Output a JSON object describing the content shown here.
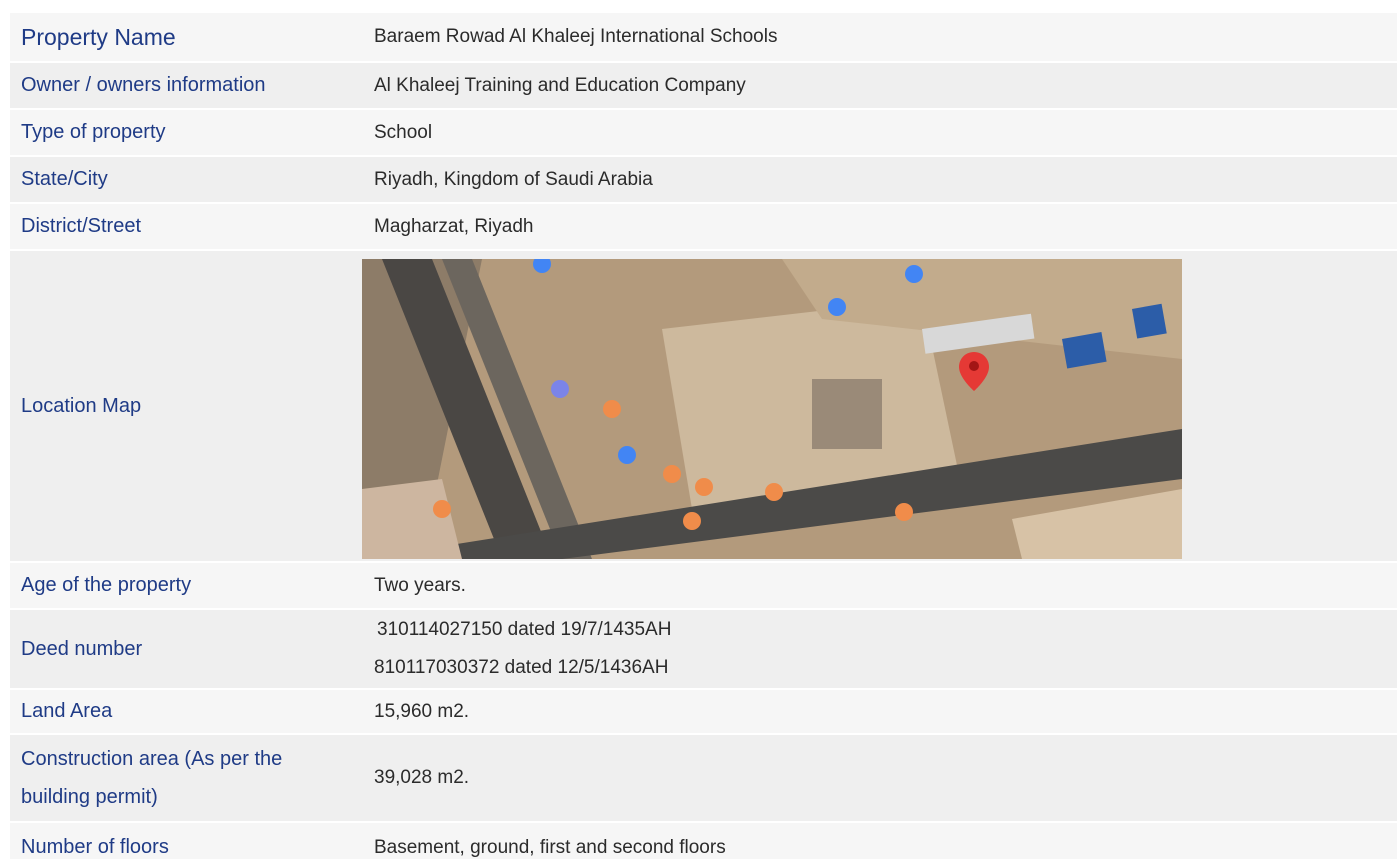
{
  "rows": {
    "property_name": {
      "label": "Property Name",
      "value": "Baraem Rowad Al Khaleej International Schools"
    },
    "owner": {
      "label": "Owner / owners information",
      "value": "Al Khaleej Training and Education Company"
    },
    "type": {
      "label": "Type of property",
      "value": "School"
    },
    "state_city": {
      "label": "State/City",
      "value": "Riyadh, Kingdom of Saudi Arabia"
    },
    "district": {
      "label": "District/Street",
      "value": "Magharzat, Riyadh"
    },
    "location_map": {
      "label": "Location Map"
    },
    "age": {
      "label": "Age of the property",
      "value": "Two years."
    },
    "deed": {
      "label": "Deed number",
      "values": [
        "310114027150 dated 19/7/1435AH",
        "810117030372 dated 12/5/1436AH"
      ]
    },
    "land_area": {
      "label": "Land Area",
      "value": "15,960 m2."
    },
    "construction_area": {
      "label_lines": [
        "Construction area (As per  the",
        "building permit)"
      ],
      "value": "39,028 m2."
    },
    "floors": {
      "label": "Number of floors",
      "value": "Basement, ground, first and second floors"
    }
  },
  "colors": {
    "label_text": "#1f3b86",
    "row_bg": "#efefef",
    "map_pin": "#e53935"
  }
}
